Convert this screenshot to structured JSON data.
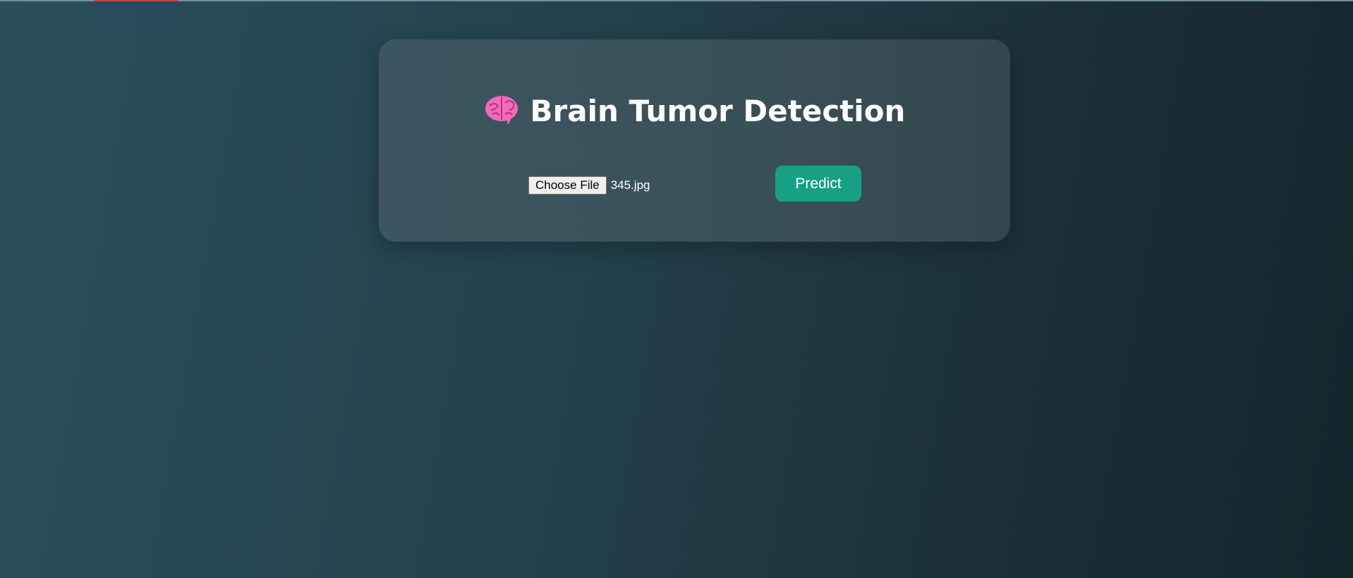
{
  "page": {
    "title_icon": "brain-icon",
    "title": "Brain Tumor Detection"
  },
  "upload": {
    "choose_label": "Choose File",
    "file_name": "345.jpg"
  },
  "actions": {
    "predict_label": "Predict"
  },
  "colors": {
    "primary_button": "#17a085",
    "card_background": "#3b525b",
    "text": "#ffffff"
  }
}
